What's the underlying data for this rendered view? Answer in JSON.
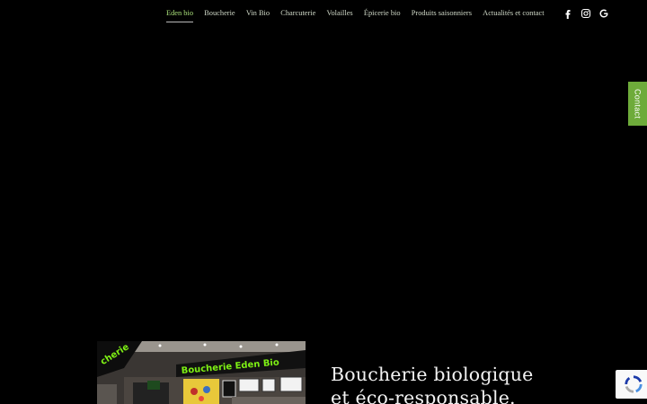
{
  "nav": {
    "items": [
      {
        "label": "Eden bio",
        "active": true
      },
      {
        "label": "Boucherie"
      },
      {
        "label": "Vin Bio"
      },
      {
        "label": "Charcuterie"
      },
      {
        "label": "Volailles"
      },
      {
        "label": "Épicerie bio"
      },
      {
        "label": "Produits saisonniers"
      },
      {
        "label": "Actualités et contact"
      }
    ]
  },
  "social": [
    "facebook-icon",
    "instagram-icon",
    "google-icon"
  ],
  "contact_tab": {
    "label": "Contact"
  },
  "hero": {
    "image_sign_text": "Boucherie Eden Bio",
    "image_left_text": "cherie"
  },
  "heading": {
    "line1": "Boucherie biologique",
    "line2": "et éco-responsable."
  },
  "colors": {
    "accent": "#a9e07a",
    "contact_bg": "#6eab3a",
    "background": "#000000"
  }
}
